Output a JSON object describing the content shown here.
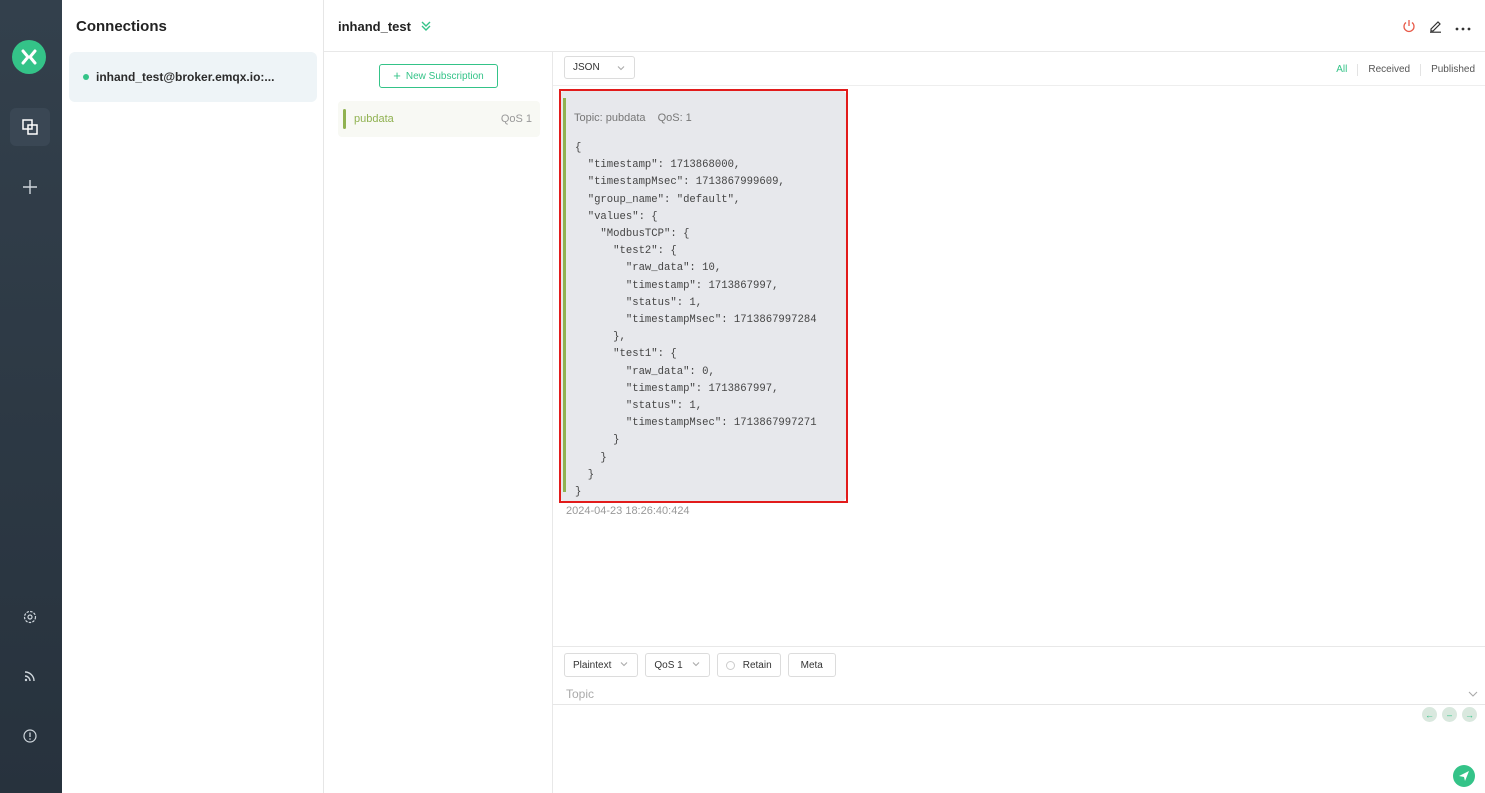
{
  "rail": {
    "icons": [
      "logo-icon",
      "connections-icon",
      "add-icon",
      "settings-icon",
      "feed-icon",
      "about-icon"
    ]
  },
  "connections": {
    "title": "Connections",
    "items": [
      {
        "label": "inhand_test@broker.emqx.io:...",
        "status_color": "#34c388"
      }
    ]
  },
  "header": {
    "connection_name": "inhand_test"
  },
  "subscriptions": {
    "new_label": "New Subscription",
    "items": [
      {
        "topic": "pubdata",
        "qos": "QoS 1",
        "color": "#90b251"
      }
    ]
  },
  "messages": {
    "format": "JSON",
    "filters": [
      "All",
      "Received",
      "Published"
    ],
    "active_filter": "All",
    "items": [
      {
        "topic": "Topic: pubdata",
        "qos": "QoS: 1",
        "payload": "{\n  \"timestamp\": 1713868000,\n  \"timestampMsec\": 1713867999609,\n  \"group_name\": \"default\",\n  \"values\": {\n    \"ModbusTCP\": {\n      \"test2\": {\n        \"raw_data\": 10,\n        \"timestamp\": 1713867997,\n        \"status\": 1,\n        \"timestampMsec\": 1713867997284\n      },\n      \"test1\": {\n        \"raw_data\": 0,\n        \"timestamp\": 1713867997,\n        \"status\": 1,\n        \"timestampMsec\": 1713867997271\n      }\n    }\n  }\n}",
        "time": "2024-04-23 18:26:40:424"
      }
    ]
  },
  "publish": {
    "payload_format": "Plaintext",
    "qos": "QoS 1",
    "retain_label": "Retain",
    "meta_label": "Meta",
    "topic_placeholder": "Topic"
  },
  "colors": {
    "accent": "#34c388",
    "highlight": "#e21b1b",
    "topic": "#90b251"
  }
}
